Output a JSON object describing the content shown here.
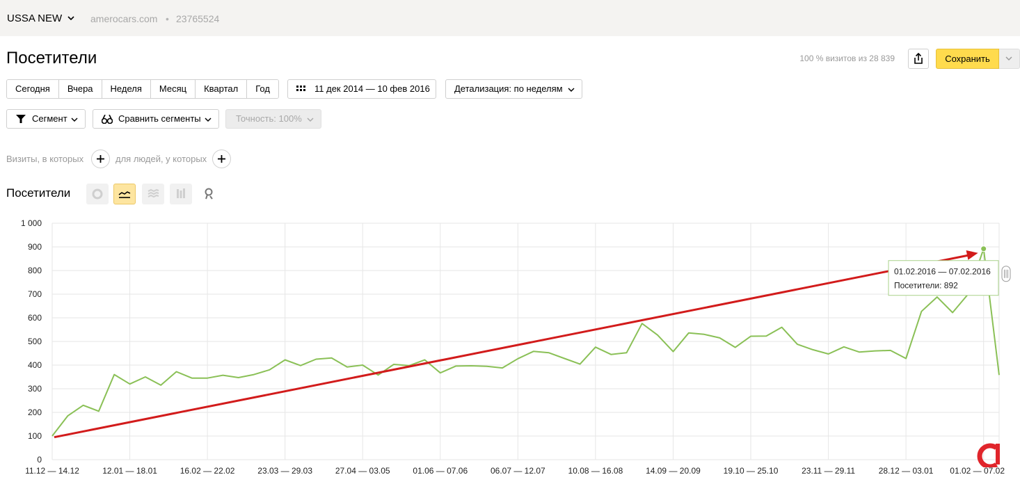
{
  "header": {
    "counter_name": "USSA NEW",
    "site": "amerocars.com",
    "separator": "•",
    "counter_id": "23765524"
  },
  "page": {
    "title": "Посетители",
    "visits_info": "100 % визитов из 28 839",
    "save_label": "Сохранить"
  },
  "periods": [
    "Сегодня",
    "Вчера",
    "Неделя",
    "Месяц",
    "Квартал",
    "Год"
  ],
  "date_range": "11 дек 2014 — 10 фев 2016",
  "detail": "Детализация: по неделям",
  "segment_label": "Сегмент",
  "compare_label": "Сравнить сегменты",
  "accuracy_label": "Точность: 100%",
  "filters": {
    "visits": "Визиты, в которых",
    "people": "для людей, у которых"
  },
  "section_title": "Посетители",
  "icons": {
    "counter": "chevron-down-icon",
    "share": "share-icon",
    "calendar": "calendar-icon",
    "segment": "funnel-icon",
    "compare": "compare-icon",
    "add": "plus-icon",
    "pie": "pie-chart-icon",
    "line": "line-chart-icon",
    "area": "area-chart-icon",
    "bar": "bar-chart-icon",
    "map": "map-pin-icon"
  },
  "colors": {
    "accent": "#ffdb4d",
    "series": "#8ac056",
    "arrow": "#d21b1b",
    "logo": "#e0252b"
  },
  "chart_data": {
    "type": "line",
    "ylim": [
      0,
      1000
    ],
    "yticks": [
      "0",
      "100",
      "200",
      "300",
      "400",
      "500",
      "600",
      "700",
      "800",
      "900",
      "1 000"
    ],
    "xtick_labels": [
      "11.12 — 14.12",
      "12.01 — 18.01",
      "16.02 — 22.02",
      "23.03 — 29.03",
      "27.04 — 03.05",
      "01.06 — 07.06",
      "06.07 — 12.07",
      "10.08 — 16.08",
      "14.09 — 20.09",
      "19.10 — 25.10",
      "23.11 — 29.11",
      "28.12 — 03.01",
      "01.02 — 07.02"
    ],
    "series": [
      {
        "values": [
          100,
          185,
          230,
          205,
          360,
          320,
          350,
          315,
          372,
          345,
          345,
          357,
          347,
          360,
          380,
          422,
          398,
          425,
          430,
          392,
          400,
          358,
          403,
          398,
          422,
          367,
          396,
          397,
          395,
          388,
          427,
          458,
          452,
          428,
          404,
          476,
          445,
          452,
          576,
          527,
          457,
          536,
          530,
          515,
          475,
          522,
          523,
          560,
          488,
          465,
          447,
          477,
          455,
          460,
          462,
          428,
          627,
          688,
          622,
          700,
          892,
          358
        ]
      }
    ],
    "tooltip": {
      "period": "01.02.2016 — 07.02.2016",
      "text": "Посетители: 892"
    }
  }
}
